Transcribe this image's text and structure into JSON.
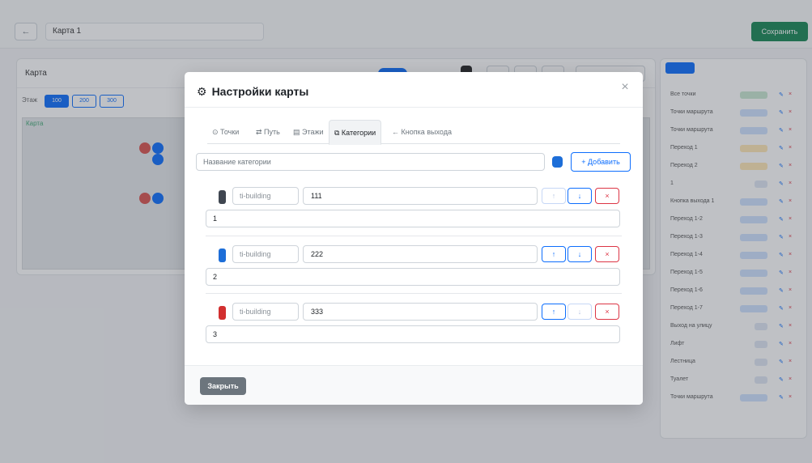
{
  "background": {
    "back_icon": "←",
    "map_name": "Карта 1",
    "save_label": "Сохранить",
    "card_title": "Карта",
    "scale_label": "Этаж",
    "scale_options": [
      "100",
      "200",
      "300"
    ],
    "map_label": "Карта",
    "sidebar_rows": [
      "Все точки",
      "Точки маршрута",
      "Точки маршрута",
      "Переход 1",
      "Переход 2",
      "1",
      "Кнопка выхода 1",
      "Переход 1-2",
      "Переход 1-3",
      "Переход 1-4",
      "Переход 1-5",
      "Переход 1-6",
      "Переход 1-7",
      "Выход на улицу",
      "Лифт",
      "Лестница",
      "Туалет",
      "Точки маршрута"
    ]
  },
  "modal": {
    "gear_icon": "⚙",
    "title": "Настройки карты",
    "close_icon": "×",
    "tabs": [
      {
        "label": "⊙ Точки"
      },
      {
        "label": "⇄ Путь"
      },
      {
        "label": "▤ Этажи"
      },
      {
        "label": "⧉ Категории"
      },
      {
        "label": "← Кнопка выхода"
      }
    ],
    "active_tab": "Категории",
    "new_category_placeholder": "Название категории",
    "new_category_color": "#1d6ed8",
    "add_button": "+ Добавить",
    "categories": [
      {
        "color": "#3f4650",
        "icon": "ti-building",
        "name": "111",
        "description": "1",
        "up_disabled": true,
        "down_disabled": false
      },
      {
        "color": "#1d6ed8",
        "icon": "ti-building",
        "name": "222",
        "description": "2",
        "up_disabled": false,
        "down_disabled": false
      },
      {
        "color": "#d22f2f",
        "icon": "ti-building",
        "name": "333",
        "description": "3",
        "up_disabled": false,
        "down_disabled": true
      }
    ],
    "up_icon": "↑",
    "down_icon": "↓",
    "delete_icon": "×",
    "footer_close": "Закрыть"
  },
  "colors": {
    "primary": "#0d6efd",
    "danger": "#dc3545",
    "secondary": "#6c757d",
    "success": "#198754"
  }
}
